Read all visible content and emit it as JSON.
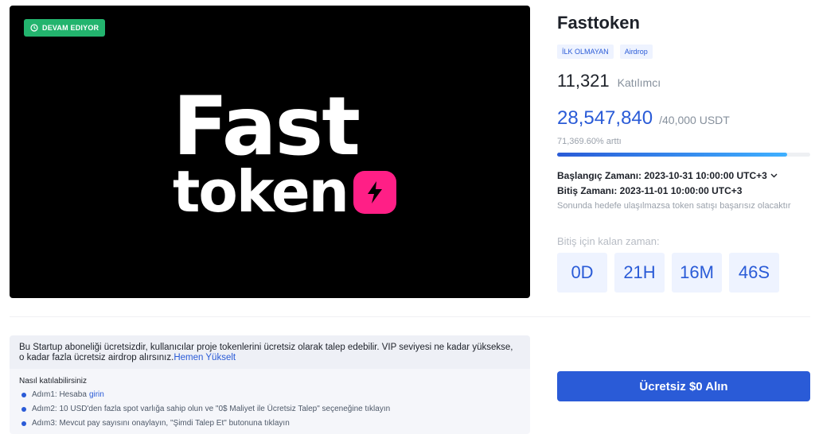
{
  "banner": {
    "status": "DEVAM EDIYOR",
    "logo_line1": "Fast",
    "logo_line2": "token",
    "brand_color": "#ff1f86"
  },
  "project": {
    "title": "Fasttoken",
    "tags": [
      "İLK OLMAYAN",
      "Airdrop"
    ],
    "participants_count": "11,321",
    "participants_label": "Katılımcı",
    "raised": "28,547,840",
    "goal": "/40,000 USDT",
    "progress_text": "71,369.60% arttı",
    "progress_fraction": 0.91,
    "start_time": "Başlangıç Zamanı: 2023-10-31 10:00:00 UTC+3",
    "end_time": "Bitiş Zamanı: 2023-11-01 10:00:00 UTC+3",
    "note": "Sonunda hedefe ulaşılmazsa token satışı başarısız olacaktır",
    "remaining_label": "Bitiş için kalan zaman:",
    "countdown": [
      "0D",
      "21H",
      "16M",
      "46S"
    ]
  },
  "info": {
    "text": "Bu Startup aboneliği ücretsizdir, kullanıcılar proje tokenlerini ücretsiz olarak talep edebilir. VIP seviyesi ne kadar yüksekse, o kadar fazla ücretsiz airdrop alırsınız.",
    "upgrade_link": "Hemen Yükselt",
    "how_title": "Nasıl katılabilirsiniz",
    "step1": "Adım1: Hesaba",
    "step1_link": "girin",
    "step2": "Adım2: 10 USD'den fazla spot varlığa sahip olun ve \"0$ Maliyet ile Ücretsiz Talep\" seçeneğine tıklayın",
    "step3": "Adım3: Mevcut pay sayısını onaylayın, \"Şimdi Talep Et\" butonuna tıklayın"
  },
  "claim_button": "Ücretsiz $0 Alın",
  "colors": {
    "accent": "#2a5bd7",
    "status_green": "#23b46e"
  }
}
